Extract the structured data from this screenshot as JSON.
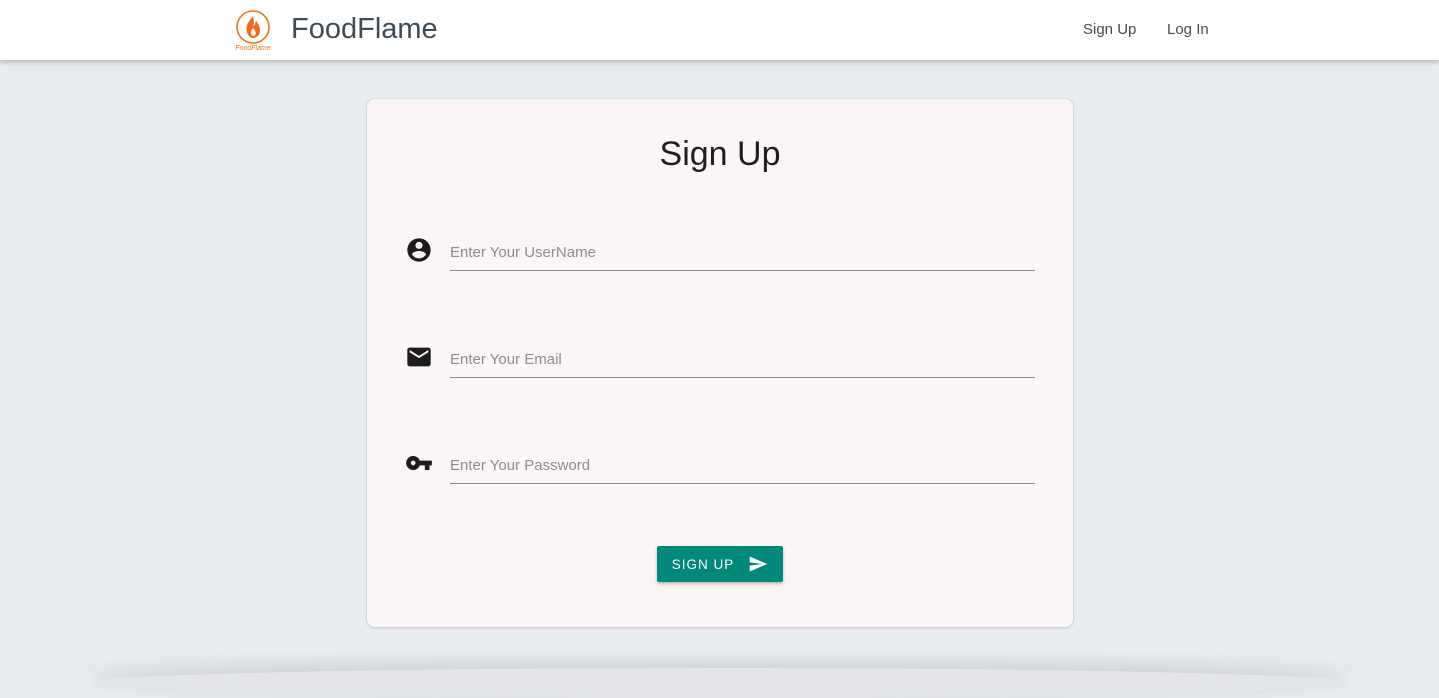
{
  "header": {
    "brand_name": "FoodFlame",
    "logo_text": "FoodFlame",
    "nav": {
      "signup_label": "Sign Up",
      "login_label": "Log In"
    }
  },
  "form": {
    "title": "Sign Up",
    "fields": {
      "username": {
        "value": "",
        "placeholder": "Enter Your UserName",
        "icon": "account-circle-icon"
      },
      "email": {
        "value": "",
        "placeholder": "Enter Your Email",
        "icon": "mail-icon"
      },
      "password": {
        "value": "",
        "placeholder": "Enter Your Password",
        "icon": "key-icon"
      }
    },
    "submit_label": "SIGN UP",
    "submit_icon": "send-icon"
  },
  "colors": {
    "accent": "#00897b",
    "logo_orange": "#e8771a",
    "page_background": "#e9ecef",
    "card_background": "#fbf5f5"
  }
}
